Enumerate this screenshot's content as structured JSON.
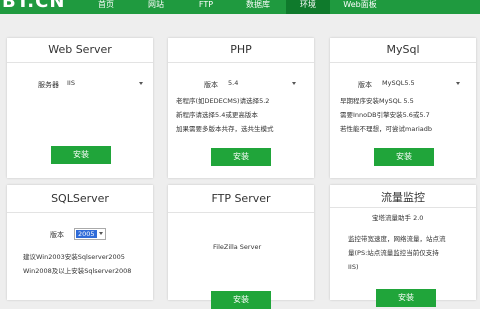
{
  "brand": {
    "logo": "BT.CN"
  },
  "nav": {
    "items": [
      {
        "label": "首页"
      },
      {
        "label": "网站"
      },
      {
        "label": "FTP"
      },
      {
        "label": "数据库"
      },
      {
        "label": "环境"
      },
      {
        "label": "Web面板"
      }
    ],
    "active": "环境"
  },
  "colors": {
    "nav_bg": "#1f9a3f",
    "nav_active": "#0f7a2c",
    "button": "#20a53a",
    "selection": "#2f6bd8"
  },
  "panels": {
    "web_server": {
      "title": "Web Server",
      "field_label": "服务器",
      "select_value": "IIS",
      "button": "安装"
    },
    "php": {
      "title": "PHP",
      "field_label": "版本",
      "select_value": "5.4",
      "notes": [
        "老程序(如DEDECMS)请选择5.2",
        "新程序请选择5.4或更高版本",
        "加果需要多版本共存，选共生模式"
      ],
      "button": "安装"
    },
    "mysql": {
      "title": "MySql",
      "field_label": "版本",
      "select_value": "MySQL5.5",
      "notes": [
        "早期程序安装MySQL 5.5",
        "需要InnoDB引擎安装5.6或5.7",
        "若性能不理想，可尝试mariadb"
      ],
      "button": "安装"
    },
    "sqlserver": {
      "title": "SQLServer",
      "field_label": "版本",
      "select_value": "2005",
      "notes": [
        "建议Win2003安装Sqlserver2005",
        "Win2008及以上安装Sqlserver2008"
      ]
    },
    "ftp_server": {
      "title": "FTP Server",
      "software": "FileZilla Server",
      "button": "安装"
    },
    "traffic": {
      "title": "流量监控",
      "subtitle": "宝塔流量助手 2.0",
      "notes": [
        "监控带宽速度，网络流量，站点流",
        "量(PS:站点流量监控当前仅支持",
        "IIS)"
      ],
      "button": "安装"
    }
  }
}
